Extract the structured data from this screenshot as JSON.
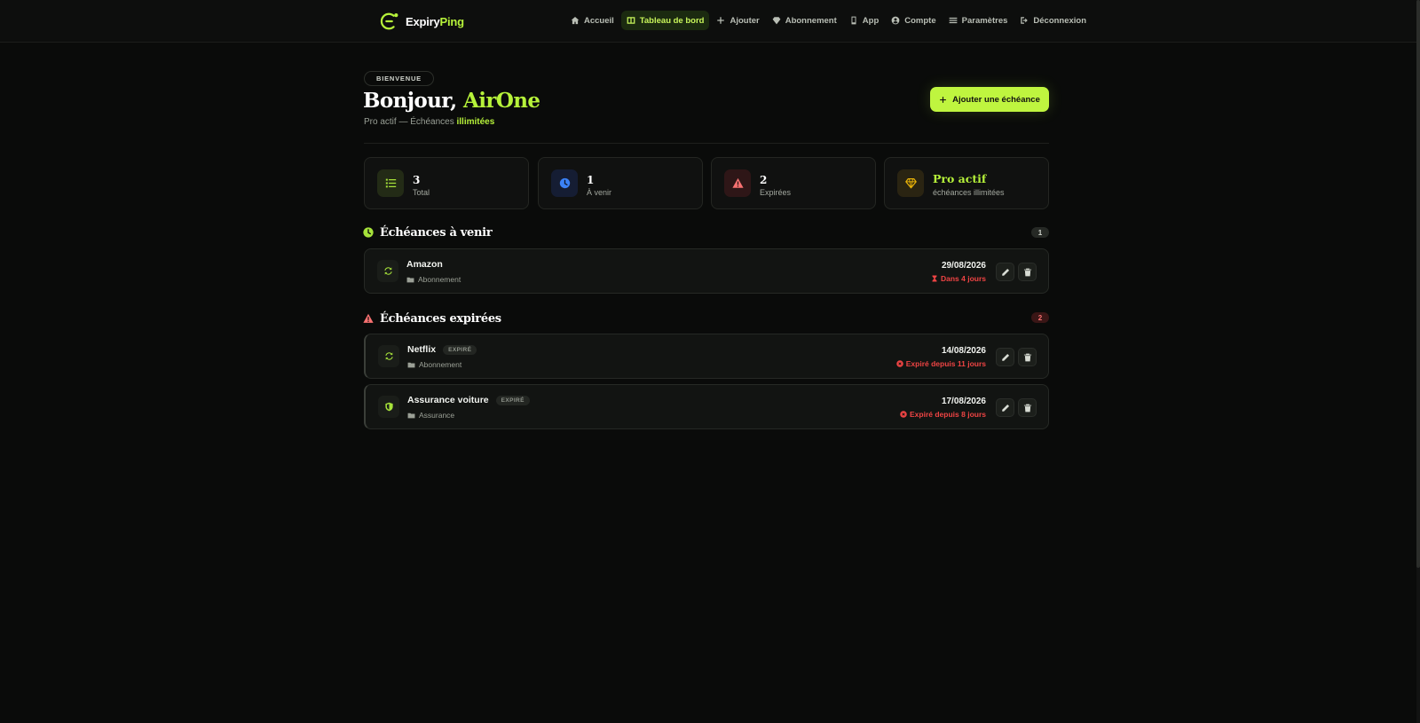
{
  "brand": {
    "name_part1": "Expiry",
    "name_part2": "Ping",
    "accent": "#b6f23a"
  },
  "nav": {
    "items": [
      {
        "label": "Accueil",
        "icon": "home-icon"
      },
      {
        "label": "Tableau de bord",
        "icon": "dashboard-icon",
        "active": true
      },
      {
        "label": "Ajouter",
        "icon": "plus-icon"
      },
      {
        "label": "Abonnement",
        "icon": "diamond-icon"
      },
      {
        "label": "App",
        "icon": "mobile-icon"
      },
      {
        "label": "Compte",
        "icon": "user-icon"
      },
      {
        "label": "Paramètres",
        "icon": "sliders-icon"
      },
      {
        "label": "Déconnexion",
        "icon": "logout-icon"
      }
    ]
  },
  "header": {
    "badge": "BIENVENUE",
    "greeting": "Bonjour,",
    "user_name": "AirOne",
    "subtitle_prefix": "Pro actif — Échéances",
    "subtitle_highlight": "illimitées",
    "add_button": "Ajouter une échéance"
  },
  "stats": [
    {
      "value": "3",
      "label": "Total",
      "icon": "list-icon",
      "color": "#a6e23a"
    },
    {
      "value": "1",
      "label": "À venir",
      "icon": "clock-icon",
      "color": "#3b82f6"
    },
    {
      "value": "2",
      "label": "Expirées",
      "icon": "warning-icon",
      "color": "#f87171"
    },
    {
      "value": "Pro actif",
      "label": "échéances illimitées",
      "icon": "gem-icon",
      "color": "#eab308"
    }
  ],
  "upcoming": {
    "title": "Échéances à venir",
    "count": "1",
    "items": [
      {
        "title": "Amazon",
        "category": "Abonnement",
        "date": "29/08/2026",
        "status": "Dans 4 jours",
        "icon": "refresh-icon"
      }
    ]
  },
  "expired": {
    "title": "Échéances expirées",
    "count": "2",
    "items": [
      {
        "title": "Netflix",
        "tag": "EXPIRÉ",
        "category": "Abonnement",
        "date": "14/08/2026",
        "status": "Expiré depuis 11 jours",
        "icon": "refresh-icon"
      },
      {
        "title": "Assurance voiture",
        "tag": "EXPIRÉ",
        "category": "Assurance",
        "date": "17/08/2026",
        "status": "Expiré depuis 8 jours",
        "icon": "shield-icon"
      }
    ]
  }
}
